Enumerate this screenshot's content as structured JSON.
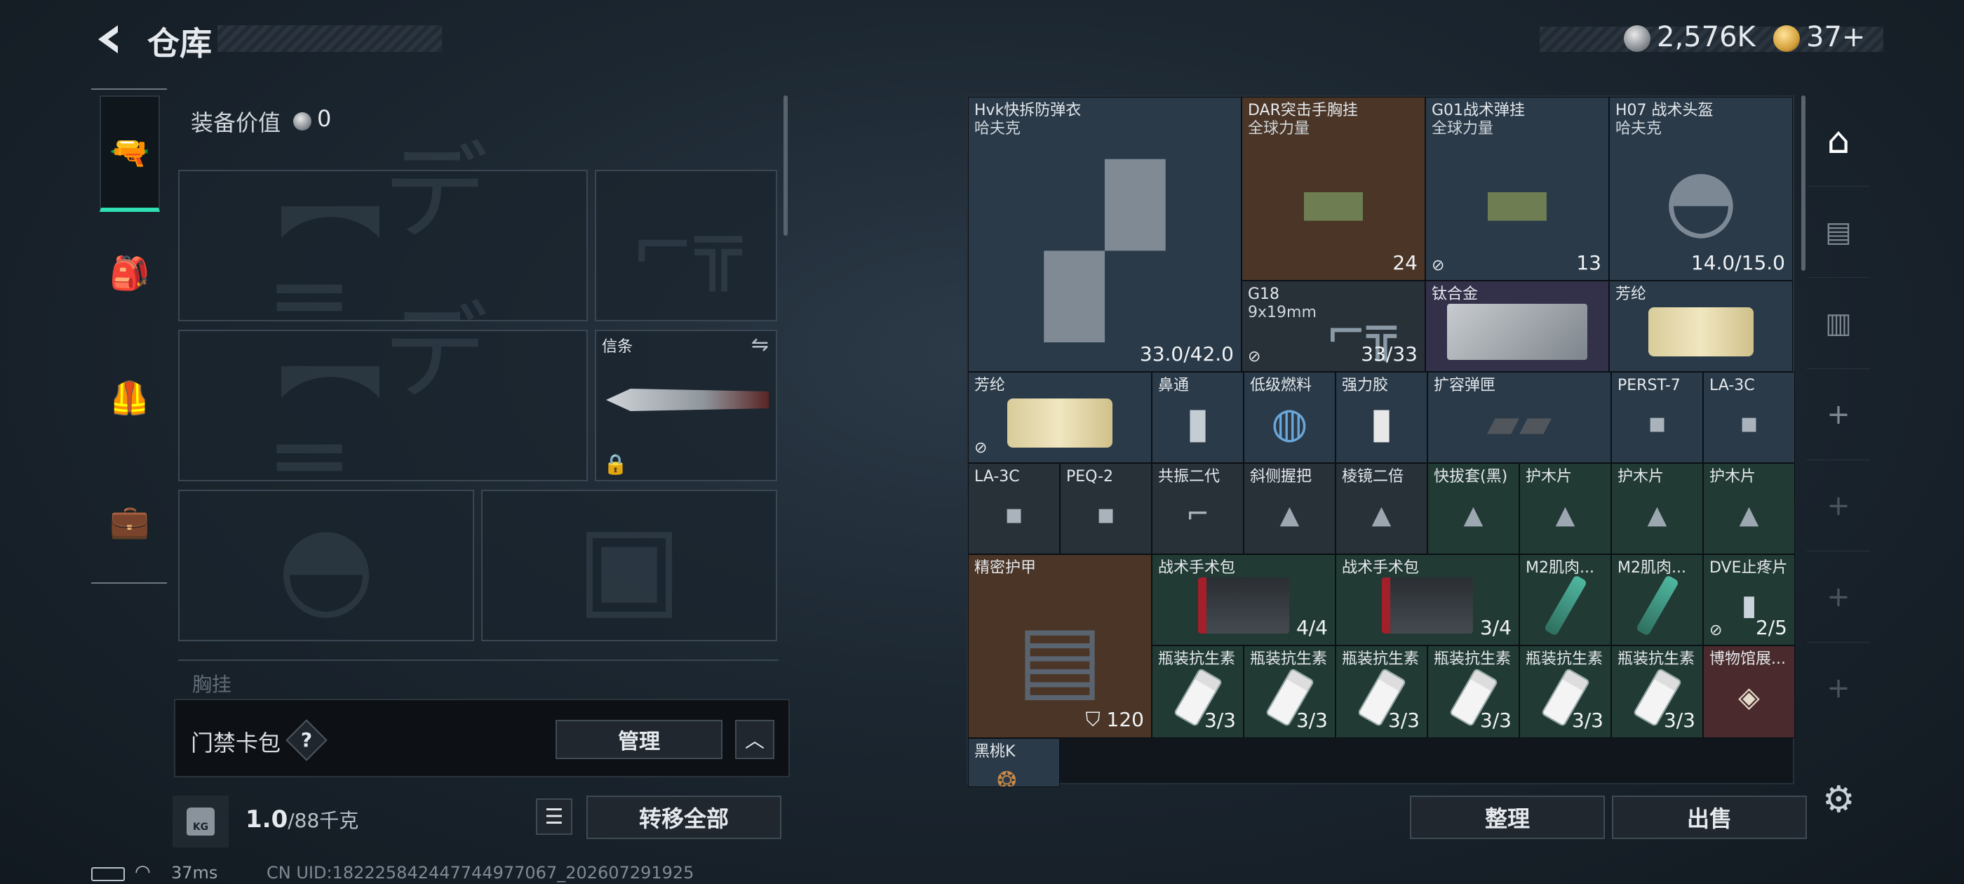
{
  "header": {
    "title": "仓库",
    "currency1": "2,576K",
    "currency2": "37+"
  },
  "left_tabs": [
    "weapon-tab",
    "backpack-tab",
    "vest-tab",
    "toolbox-tab"
  ],
  "equip": {
    "value_label": "装备价值",
    "value": "0",
    "melee_label": "信条",
    "vest_peek": "胸挂"
  },
  "card": {
    "label": "门禁卡包",
    "help": "?",
    "manage": "管理"
  },
  "bottom": {
    "weight": "1.0",
    "weight_cap": "/88千克",
    "transfer": "转移全部"
  },
  "status": {
    "ping": "37ms",
    "uid": "CN UID:1822258424477449770​67_202607291925"
  },
  "grid": {
    "sort": "整理",
    "sell": "出售",
    "items": [
      {
        "name": "Hvk快拆防弹衣",
        "sub": "哈夫克",
        "qty": "33.0/42.0"
      },
      {
        "name": "DAR突击手胸挂",
        "sub": "全球力量",
        "qty": "24"
      },
      {
        "name": "G01战术弹挂",
        "sub": "全球力量",
        "qty": "13"
      },
      {
        "name": "H07 战术头盔",
        "sub": "哈夫克",
        "qty": "14.0/15.0"
      },
      {
        "name": "G18",
        "sub": "9x19mm",
        "qty": "33/33"
      },
      {
        "name": "钛合金"
      },
      {
        "name": "芳纶"
      },
      {
        "name": "芳纶"
      },
      {
        "name": "鼻通"
      },
      {
        "name": "低级燃料"
      },
      {
        "name": "强力胶"
      },
      {
        "name": "扩容弹匣"
      },
      {
        "name": "PERST-7"
      },
      {
        "name": "LA-3C"
      },
      {
        "name": "LA-3C"
      },
      {
        "name": "PEQ-2"
      },
      {
        "name": "共振二代"
      },
      {
        "name": "斜侧握把"
      },
      {
        "name": "棱镜二倍"
      },
      {
        "name": "快拔套(黑)"
      },
      {
        "name": "护木片"
      },
      {
        "name": "护木片"
      },
      {
        "name": "护木片"
      },
      {
        "name": "精密护甲",
        "qty": "120"
      },
      {
        "name": "战术手术包",
        "qty": "4/4"
      },
      {
        "name": "战术手术包",
        "qty": "3/4"
      },
      {
        "name": "M2肌肉..."
      },
      {
        "name": "M2肌肉..."
      },
      {
        "name": "DVE止疼片",
        "qty": "2/5"
      },
      {
        "name": "瓶装抗生素",
        "qty": "3/3"
      },
      {
        "name": "瓶装抗生素",
        "qty": "3/3"
      },
      {
        "name": "瓶装抗生素",
        "qty": "3/3"
      },
      {
        "name": "瓶装抗生素",
        "qty": "3/3"
      },
      {
        "name": "瓶装抗生素",
        "qty": "3/3"
      },
      {
        "name": "瓶装抗生素",
        "qty": "3/3"
      },
      {
        "name": "博物馆展..."
      },
      {
        "name": "黑桃K"
      }
    ]
  },
  "colors": {
    "accent": "#2ee0b4",
    "blue": "#2a3a49",
    "brown": "#4a3526",
    "purple": "#33304a",
    "green": "#223a34",
    "red": "#4a2a2c"
  }
}
